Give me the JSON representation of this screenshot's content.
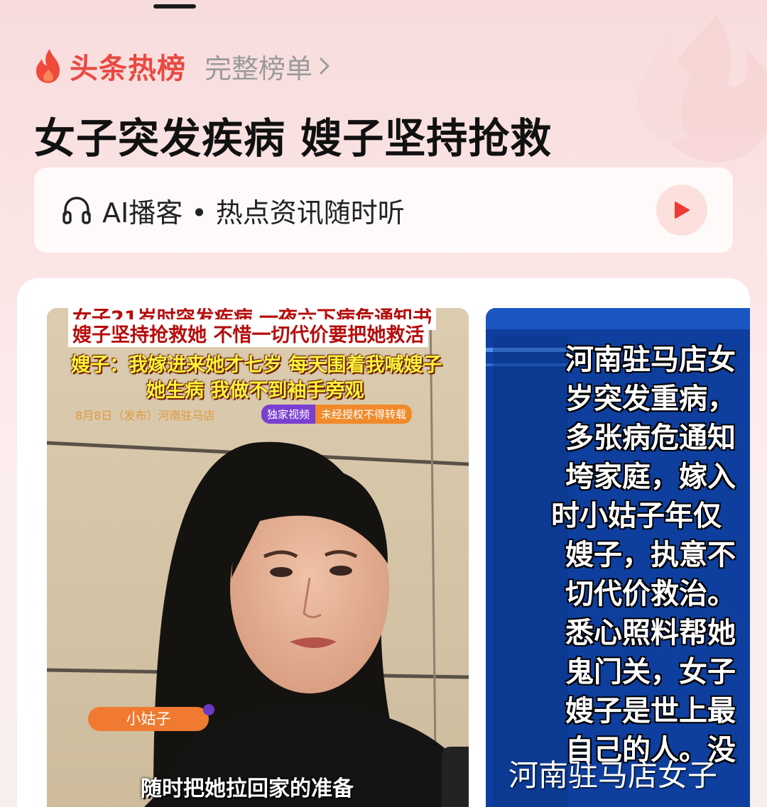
{
  "header": {
    "brand": "头条热榜",
    "full_list_label": "完整榜单",
    "icons": [
      "flame-icon",
      "chevron-right-icon"
    ]
  },
  "headline": "女子突发疾病 嫂子坚持抢救",
  "podcast": {
    "label": "AI播客 • 热点资讯随时听",
    "icons": [
      "headphones-icon",
      "play-icon"
    ]
  },
  "media": {
    "image1": {
      "subtitle_top": "嫂子坚持抢救她 不惜一切代价要把她救活",
      "subtitle_quote_1": "嫂子：我嫁进来她才七岁 每天围着我喊嫂子",
      "subtitle_quote_2": "她生病 我做不到袖手旁观",
      "date_tag": "8月8日（发布）河南驻马店",
      "exclusive_label": "独家视频",
      "no_repost_label": "未经授权不得转载",
      "name_tag": "小姑子",
      "bottom_caption": "随时把她拉回家的准备"
    },
    "image2": {
      "lines": [
        "河南驻马店女",
        "岁突发重病，",
        "多张病危通知",
        "垮家庭，嫁入",
        "时小姑子年仅",
        "嫂子，执意不",
        "切代价救治。",
        "悉心照料帮她",
        "鬼门关，女子",
        "嫂子是世上最",
        "自己的人。没"
      ],
      "caption": "河南驻马店女子"
    }
  },
  "colors": {
    "brand_red": "#e84a42",
    "muted_gray": "#9a9a9a",
    "play_bg": "#fbe0dd",
    "blue_bg": "#0d3f9f"
  }
}
